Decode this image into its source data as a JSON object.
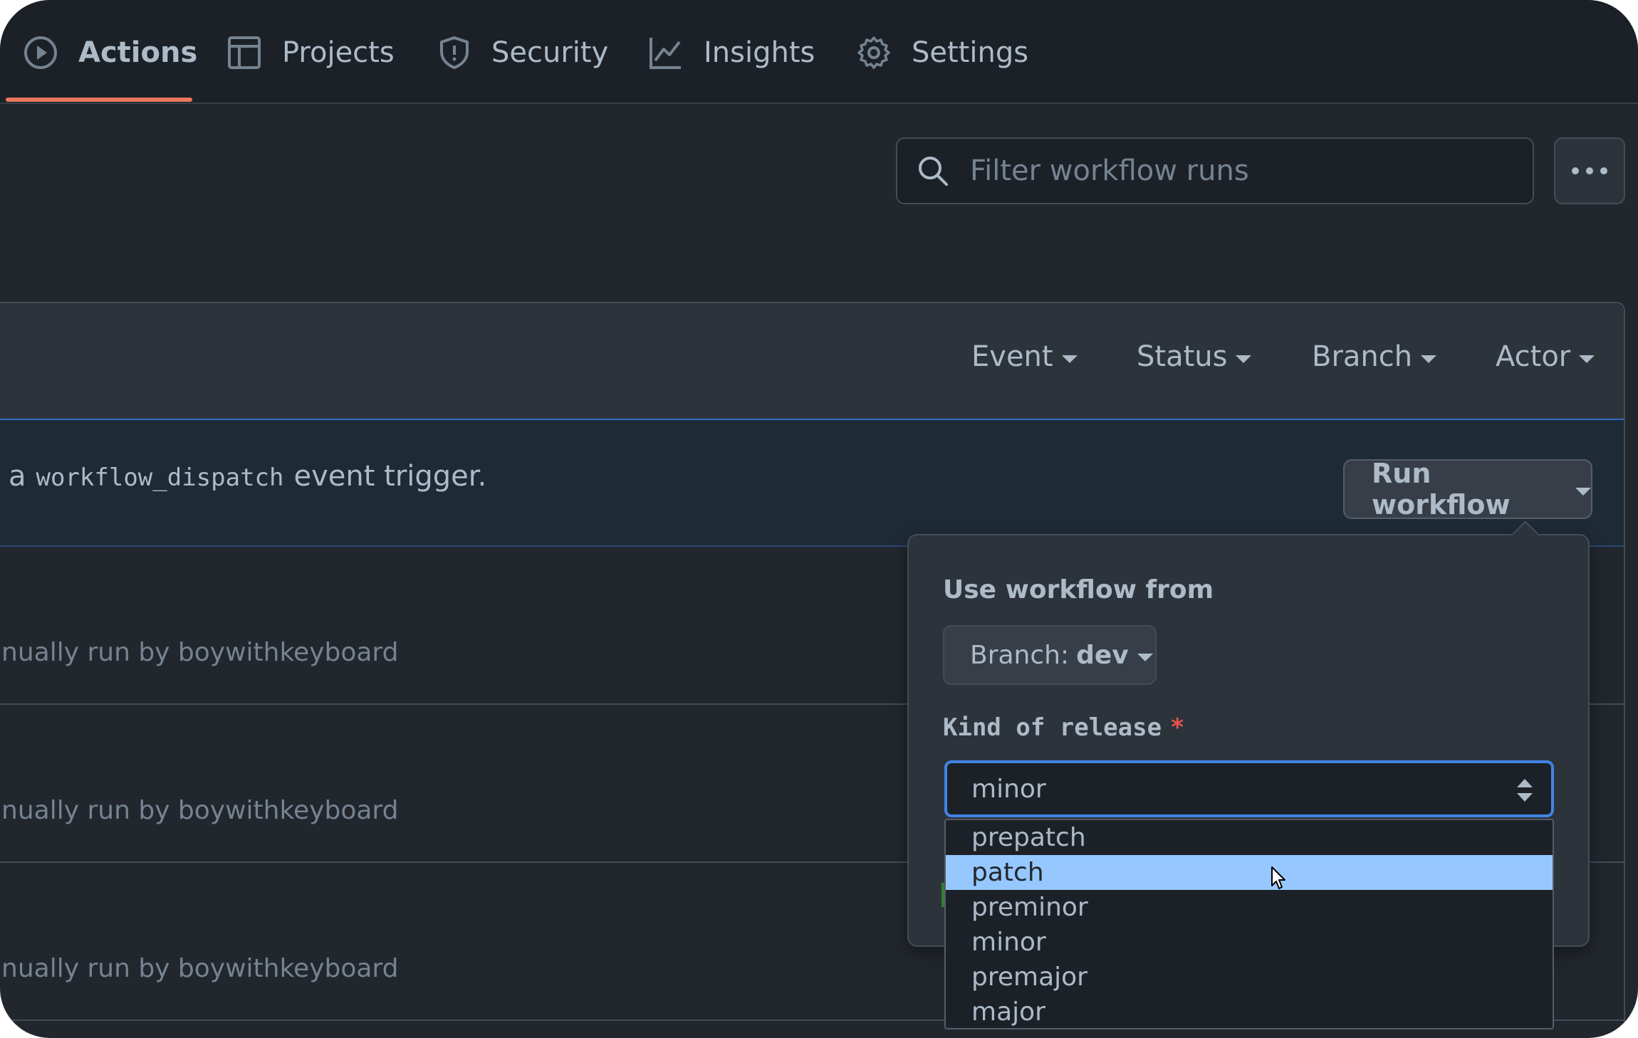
{
  "nav": {
    "tabs": [
      {
        "label": "Actions",
        "icon": "play-icon",
        "active": true
      },
      {
        "label": "Projects",
        "icon": "table-icon"
      },
      {
        "label": "Security",
        "icon": "shield-icon"
      },
      {
        "label": "Insights",
        "icon": "graph-icon"
      },
      {
        "label": "Settings",
        "icon": "gear-icon"
      }
    ]
  },
  "search": {
    "placeholder": "Filter workflow runs"
  },
  "filters": [
    "Event",
    "Status",
    "Branch",
    "Actor"
  ],
  "banner": {
    "prefix": "a",
    "code": "workflow_dispatch",
    "suffix": "event trigger.",
    "button": "Run workflow"
  },
  "runs": [
    {
      "meta": "nually run by boywithkeyboard"
    },
    {
      "meta": "nually run by boywithkeyboard"
    },
    {
      "meta": "nually run by boywithkeyboard"
    }
  ],
  "popover": {
    "title": "Use workflow from",
    "branch_prefix": "Branch:",
    "branch_value": "dev",
    "input_label": "Kind of release",
    "required_mark": "*",
    "selected_value": "minor",
    "options": [
      "prepatch",
      "patch",
      "preminor",
      "minor",
      "premajor",
      "major"
    ],
    "highlighted_option": "patch"
  },
  "colors": {
    "accent_underline": "#ec775c",
    "focus_border": "#4184e4",
    "option_highlight": "#96c8ff",
    "required": "#e5534b"
  }
}
